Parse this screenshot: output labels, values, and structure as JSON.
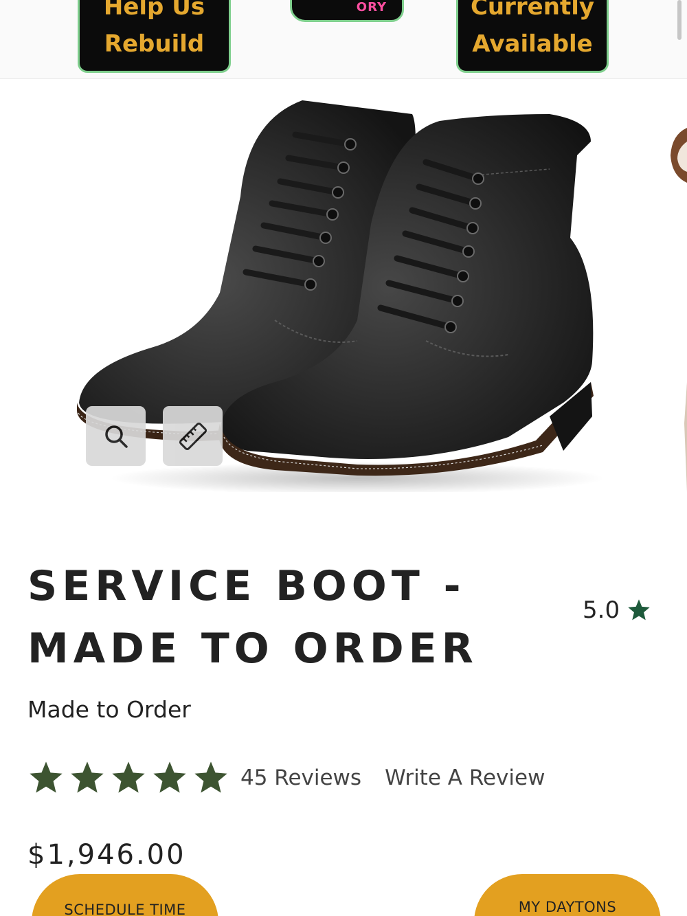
{
  "banner": {
    "left_button": {
      "line1": "Help Us",
      "line2": "Rebuild"
    },
    "center_logo_text": "ORY",
    "right_button": {
      "line1": "Currently",
      "line2": "Available"
    }
  },
  "gallery": {
    "zoom_icon": "magnifier-icon",
    "size_guide_icon": "ruler-icon"
  },
  "product": {
    "title_line1": "SERVICE BOOT -",
    "title_line2": "MADE TO ORDER",
    "subtitle": "Made to Order",
    "rating_value": "5.0",
    "rating_star": "★",
    "star_count": 5,
    "reviews_label": "45 Reviews",
    "write_review_label": "Write A Review",
    "price": "$1,946.00"
  },
  "actions": {
    "left_label": "SCHEDULE TIME",
    "right_label": "MY DAYTONS"
  },
  "colors": {
    "accent": "#e3a020",
    "star_green": "#3d5431",
    "rating_star_green": "#1d5a3b",
    "banner_border": "#7fcf8d",
    "banner_text": "#e5a82f"
  }
}
